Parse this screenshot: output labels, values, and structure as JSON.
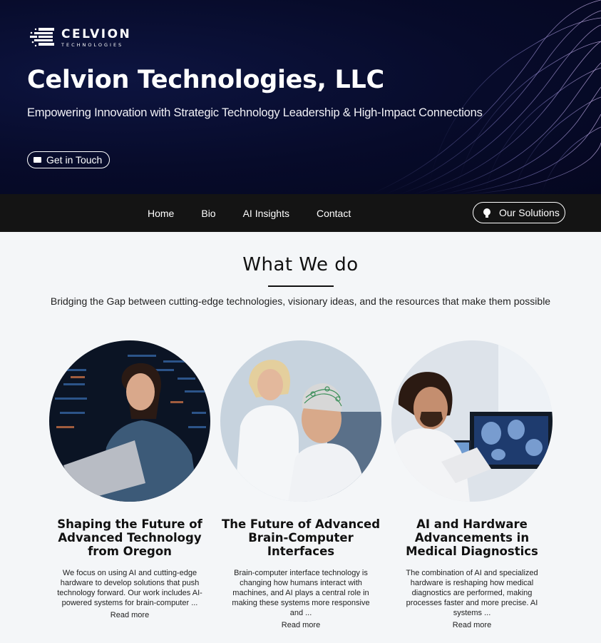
{
  "hero": {
    "logo_main": "CELVION",
    "logo_sub": "TECHNOLOGIES",
    "title": "Celvion Technologies, LLC",
    "tagline": "Empowering Innovation with Strategic Technology Leadership & High-Impact Connections",
    "cta_label": "Get in Touch"
  },
  "nav": {
    "links": [
      "Home",
      "Bio",
      "AI Insights",
      "Contact"
    ],
    "solutions_label": "Our Solutions"
  },
  "section": {
    "title": "What We do",
    "subtitle": "Bridging the Gap between cutting-edge technologies, visionary ideas, and the resources that make them possible"
  },
  "cards": [
    {
      "title": "Shaping the Future of Advanced Technology from Oregon",
      "text": "We focus on using AI and cutting-edge hardware to develop solutions that push technology forward. Our work includes AI-powered systems for brain-computer ...",
      "more": "Read more"
    },
    {
      "title": "The Future of Advanced Brain-Computer Interfaces",
      "text": "Brain-computer interface technology is changing how humans interact with machines, and AI plays a central role in making these systems more responsive and ...",
      "more": "Read more"
    },
    {
      "title": "AI and Hardware Advancements in Medical Diagnostics",
      "text": "The combination of AI and specialized hardware is reshaping how medical diagnostics are performed, making processes faster and more precise. AI systems ...",
      "more": "Read more"
    }
  ],
  "colors": {
    "hero_bg": "#070b2a",
    "nav_bg": "#141414",
    "page_bg": "#f4f6f8"
  }
}
